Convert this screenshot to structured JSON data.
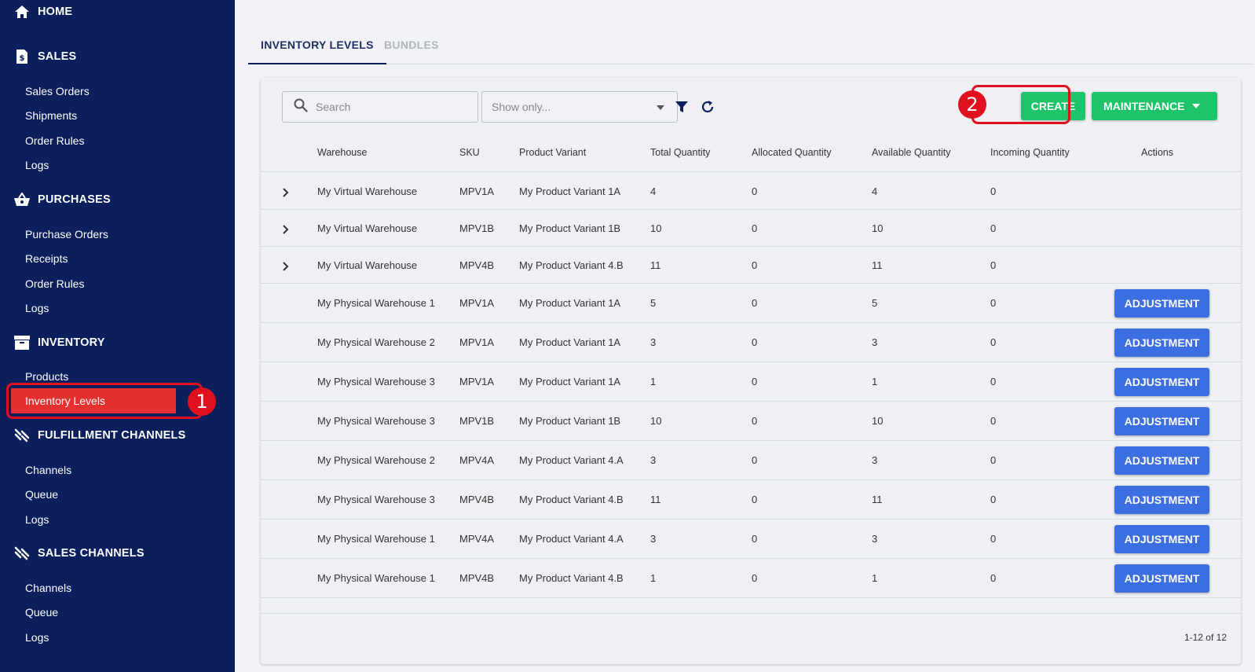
{
  "sidebar": {
    "home": "HOME",
    "sections": [
      {
        "label": "SALES",
        "icon": "dollar-document-icon",
        "items": [
          "Sales Orders",
          "Shipments",
          "Order Rules",
          "Logs"
        ]
      },
      {
        "label": "PURCHASES",
        "icon": "basket-icon",
        "items": [
          "Purchase Orders",
          "Receipts",
          "Order Rules",
          "Logs"
        ]
      },
      {
        "label": "INVENTORY",
        "icon": "archive-box-icon",
        "items": [
          "Products",
          "Inventory Levels"
        ]
      },
      {
        "label": "FULFILLMENT CHANNELS",
        "icon": "channel-icon",
        "items": [
          "Channels",
          "Queue",
          "Logs"
        ]
      },
      {
        "label": "SALES CHANNELS",
        "icon": "channel-icon",
        "items": [
          "Channels",
          "Queue",
          "Logs"
        ]
      }
    ],
    "active_item": "Inventory Levels"
  },
  "annotations": {
    "badge1": "1",
    "badge2": "2",
    "color": "#e0101e"
  },
  "tabs": [
    {
      "label": "INVENTORY LEVELS",
      "active": true
    },
    {
      "label": "BUNDLES",
      "active": false
    }
  ],
  "toolbar": {
    "search_placeholder": "Search",
    "filter_placeholder": "Show only...",
    "create_label": "CREATE",
    "maintenance_label": "MAINTENANCE"
  },
  "table": {
    "columns": [
      "Warehouse",
      "SKU",
      "Product Variant",
      "Total Quantity",
      "Allocated Quantity",
      "Available Quantity",
      "Incoming Quantity",
      "Actions"
    ],
    "action_label": "ADJUSTMENT",
    "rows": [
      {
        "warehouse": "My Virtual Warehouse",
        "sku": "MPV1A",
        "variant": "My Product Variant 1A",
        "total": "4",
        "allocated": "0",
        "available": "4",
        "incoming": "0",
        "expandable": true
      },
      {
        "warehouse": "My Virtual Warehouse",
        "sku": "MPV1B",
        "variant": "My Product Variant 1B",
        "total": "10",
        "allocated": "0",
        "available": "10",
        "incoming": "0",
        "expandable": true
      },
      {
        "warehouse": "My Virtual Warehouse",
        "sku": "MPV4B",
        "variant": "My Product Variant 4.B",
        "total": "11",
        "allocated": "0",
        "available": "11",
        "incoming": "0",
        "expandable": true
      },
      {
        "warehouse": "My Physical Warehouse 1",
        "sku": "MPV1A",
        "variant": "My Product Variant 1A",
        "total": "5",
        "allocated": "0",
        "available": "5",
        "incoming": "0",
        "expandable": false
      },
      {
        "warehouse": "My Physical Warehouse 2",
        "sku": "MPV1A",
        "variant": "My Product Variant 1A",
        "total": "3",
        "allocated": "0",
        "available": "3",
        "incoming": "0",
        "expandable": false
      },
      {
        "warehouse": "My Physical Warehouse 3",
        "sku": "MPV1A",
        "variant": "My Product Variant 1A",
        "total": "1",
        "allocated": "0",
        "available": "1",
        "incoming": "0",
        "expandable": false
      },
      {
        "warehouse": "My Physical Warehouse 3",
        "sku": "MPV1B",
        "variant": "My Product Variant 1B",
        "total": "10",
        "allocated": "0",
        "available": "10",
        "incoming": "0",
        "expandable": false
      },
      {
        "warehouse": "My Physical Warehouse 2",
        "sku": "MPV4A",
        "variant": "My Product Variant 4.A",
        "total": "3",
        "allocated": "0",
        "available": "3",
        "incoming": "0",
        "expandable": false
      },
      {
        "warehouse": "My Physical Warehouse 3",
        "sku": "MPV4B",
        "variant": "My Product Variant 4.B",
        "total": "11",
        "allocated": "0",
        "available": "11",
        "incoming": "0",
        "expandable": false
      },
      {
        "warehouse": "My Physical Warehouse 1",
        "sku": "MPV4A",
        "variant": "My Product Variant 4.A",
        "total": "3",
        "allocated": "0",
        "available": "3",
        "incoming": "0",
        "expandable": false
      },
      {
        "warehouse": "My Physical Warehouse 1",
        "sku": "MPV4B",
        "variant": "My Product Variant 4.B",
        "total": "1",
        "allocated": "0",
        "available": "1",
        "incoming": "0",
        "expandable": false
      }
    ]
  },
  "pagination": "1-12 of 12",
  "colors": {
    "sidebar": "#0b1f5c",
    "active_nav": "#e53030",
    "create": "#1fc46a",
    "adjust": "#3b6ee0"
  }
}
